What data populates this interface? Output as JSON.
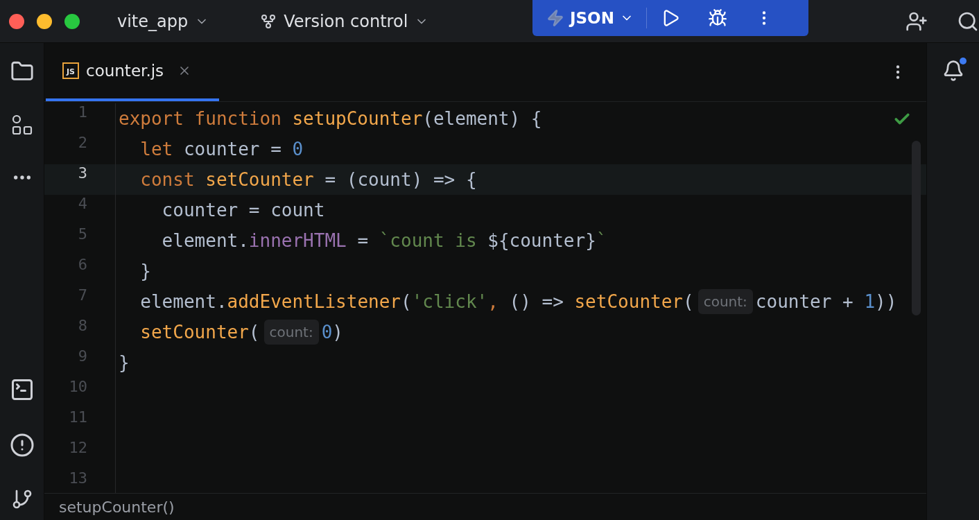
{
  "window": {
    "project": "vite_app",
    "vcs": "Version control",
    "run_config": "JSON"
  },
  "tabs": [
    {
      "label": "counter.js",
      "badge": "JS",
      "selected": true
    }
  ],
  "editor": {
    "lines": [
      {
        "number": "1",
        "current": false,
        "segments": [
          {
            "kind": "code",
            "tokens": [
              {
                "kind": "kw",
                "text": "export function "
              },
              {
                "kind": "fn",
                "text": "setupCounter"
              },
              {
                "kind": "plain",
                "text": "(element) {"
              }
            ]
          }
        ]
      },
      {
        "number": "2",
        "current": false,
        "segments": [
          {
            "kind": "code",
            "tokens": [
              {
                "kind": "kw",
                "text": "  let "
              },
              {
                "kind": "plain",
                "text": "counter = "
              },
              {
                "kind": "num",
                "text": "0"
              }
            ]
          }
        ]
      },
      {
        "number": "3",
        "current": true,
        "segments": [
          {
            "kind": "code",
            "tokens": [
              {
                "kind": "kw",
                "text": "  const "
              },
              {
                "kind": "fn",
                "text": "setCounter"
              },
              {
                "kind": "plain",
                "text": " = (count) => {"
              }
            ]
          }
        ]
      },
      {
        "number": "4",
        "current": false,
        "segments": [
          {
            "kind": "code",
            "tokens": [
              {
                "kind": "plain",
                "text": "    counter = count"
              }
            ]
          }
        ]
      },
      {
        "number": "5",
        "current": false,
        "segments": [
          {
            "kind": "code",
            "tokens": [
              {
                "kind": "plain",
                "text": "    element."
              },
              {
                "kind": "prop",
                "text": "innerHTML"
              },
              {
                "kind": "plain",
                "text": " = "
              },
              {
                "kind": "str",
                "text": "`count is "
              },
              {
                "kind": "plain",
                "text": "${counter}"
              },
              {
                "kind": "str",
                "text": "`"
              }
            ]
          }
        ]
      },
      {
        "number": "6",
        "current": false,
        "segments": [
          {
            "kind": "code",
            "tokens": [
              {
                "kind": "plain",
                "text": "  }"
              }
            ]
          }
        ]
      },
      {
        "number": "7",
        "current": false,
        "segments": [
          {
            "kind": "code",
            "tokens": [
              {
                "kind": "plain",
                "text": "  element."
              },
              {
                "kind": "fn",
                "text": "addEventListener"
              },
              {
                "kind": "plain",
                "text": "("
              },
              {
                "kind": "str",
                "text": "'click'"
              },
              {
                "kind": "kw",
                "text": ","
              },
              {
                "kind": "plain",
                "text": " () => "
              },
              {
                "kind": "fn",
                "text": "setCounter"
              },
              {
                "kind": "plain",
                "text": "("
              }
            ]
          },
          {
            "kind": "hint",
            "text": "count:"
          },
          {
            "kind": "code",
            "tokens": [
              {
                "kind": "plain",
                "text": "counter + "
              },
              {
                "kind": "num",
                "text": "1"
              },
              {
                "kind": "plain",
                "text": "))"
              }
            ]
          }
        ]
      },
      {
        "number": "8",
        "current": false,
        "segments": [
          {
            "kind": "code",
            "tokens": [
              {
                "kind": "fn",
                "text": "  setCounter"
              },
              {
                "kind": "plain",
                "text": "("
              }
            ]
          },
          {
            "kind": "hint",
            "text": "count:"
          },
          {
            "kind": "code",
            "tokens": [
              {
                "kind": "num",
                "text": "0"
              },
              {
                "kind": "plain",
                "text": ")"
              }
            ]
          }
        ]
      },
      {
        "number": "9",
        "current": false,
        "segments": [
          {
            "kind": "code",
            "tokens": [
              {
                "kind": "plain",
                "text": "}"
              }
            ]
          }
        ]
      },
      {
        "number": "10",
        "current": false
      },
      {
        "number": "11",
        "current": false
      },
      {
        "number": "12",
        "current": false
      },
      {
        "number": "13",
        "current": false
      }
    ]
  },
  "notifications": {
    "unread": true
  },
  "breadcrumb": "setupCounter()"
}
